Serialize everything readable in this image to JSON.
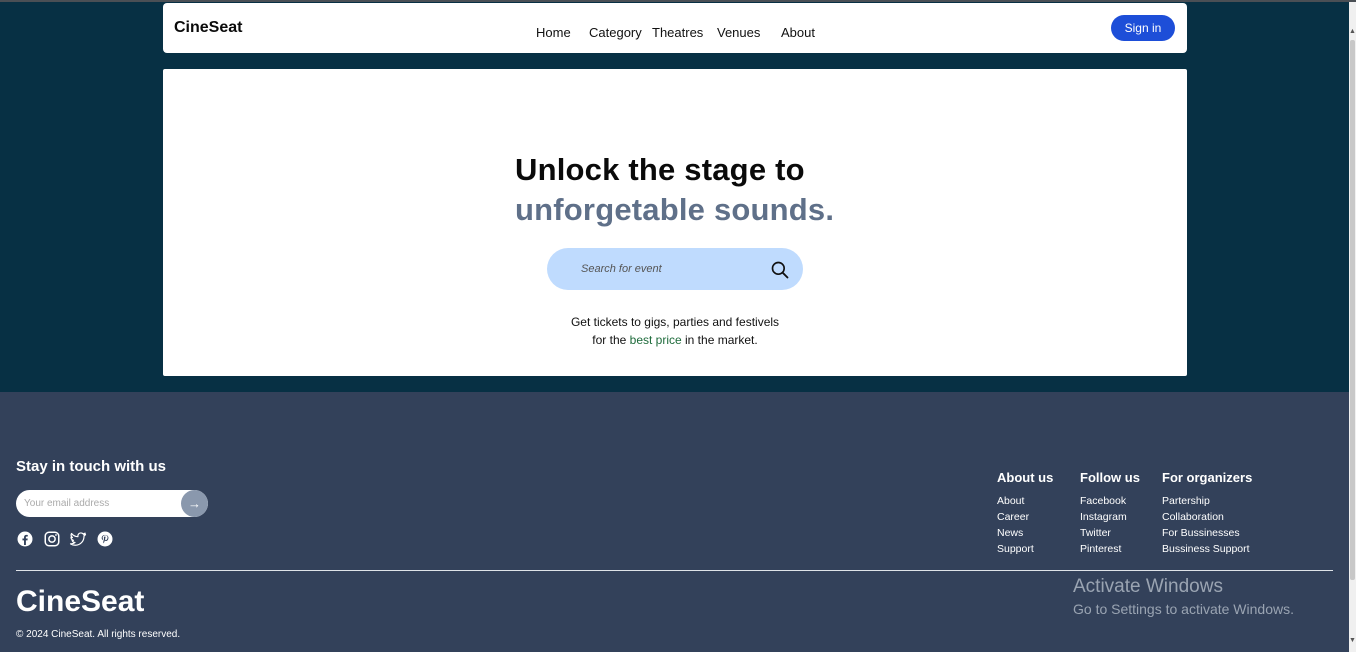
{
  "nav": {
    "brand": "CineSeat",
    "links": [
      "Home",
      "Category",
      "Theatres",
      "Venues",
      "About"
    ],
    "signin": "Sign in"
  },
  "hero": {
    "line1": "Unlock the stage to",
    "line2": "unforgetable sounds.",
    "search_placeholder": "Search for event",
    "sub_line1": "Get tickets to gigs, parties and festivels",
    "sub_line2_pre": "for the ",
    "sub_line2_highlight": "best price",
    "sub_line2_post": " in the market."
  },
  "footer": {
    "stay_title": "Stay in touch with us",
    "email_placeholder": "Your email address",
    "email_button": "→",
    "social_icons": [
      "facebook-icon",
      "instagram-icon",
      "twitter-icon",
      "pinterest-icon"
    ],
    "columns": [
      {
        "title": "About us",
        "items": [
          "About",
          "Career",
          "News",
          "Support"
        ]
      },
      {
        "title": "Follow us",
        "items": [
          "Facebook",
          "Instagram",
          "Twitter",
          "Pinterest"
        ]
      },
      {
        "title": "For organizers",
        "items": [
          "Partership",
          "Collaboration",
          "For Bussinesses",
          "Bussiness Support"
        ]
      }
    ],
    "brand": "CineSeat",
    "copyright": "© 2024 CineSeat. All rights reserved."
  },
  "watermark": {
    "line1": "Activate Windows",
    "line2": "Go to Settings to activate Windows."
  },
  "colors": {
    "hero_bg": "#073044",
    "footer_bg": "#33415a",
    "signin_bg": "#1d4ed8",
    "search_bg": "#bfdbfe",
    "accent_text": "#5f7089",
    "highlight_green": "#1e6b3b"
  }
}
